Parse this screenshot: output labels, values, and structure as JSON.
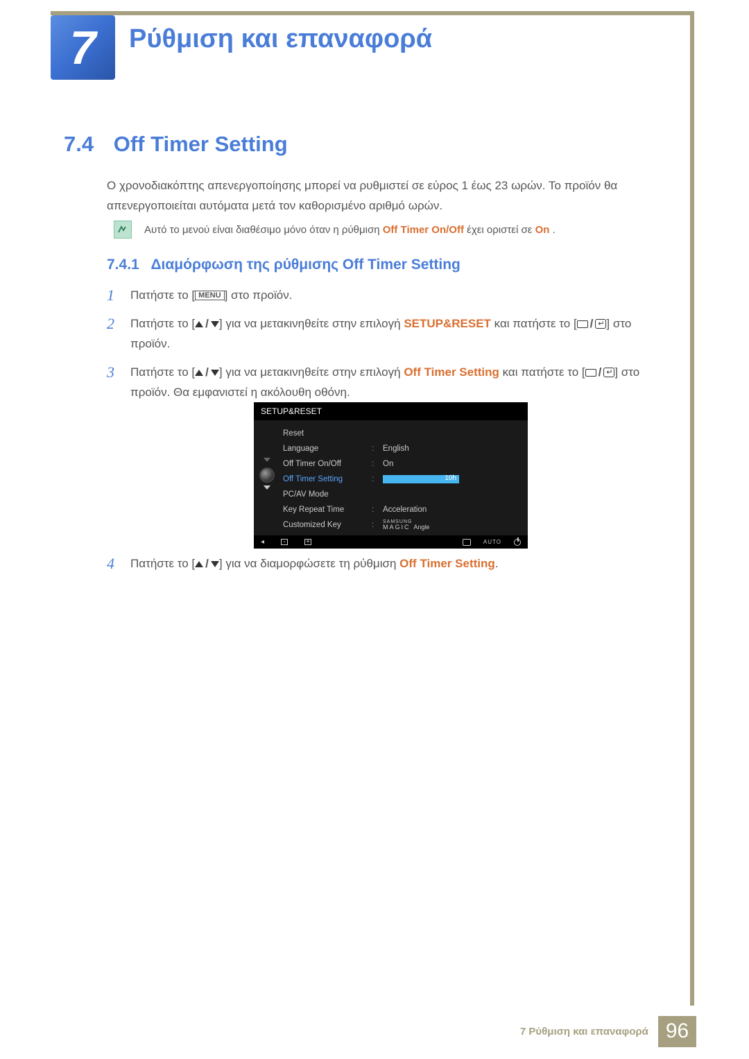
{
  "chapter": {
    "number": "7",
    "title": "Ρύθμιση και επαναφορά"
  },
  "section": {
    "number": "7.4",
    "title": "Off Timer Setting"
  },
  "intro": "Ο χρονοδιακόπτης απενεργοποίησης μπορεί να ρυθμιστεί σε εύρος 1 έως 23 ωρών. Το προϊόν θα απενεργοποιείται αυτόματα μετά τον καθορισμένο αριθμό ωρών.",
  "note": {
    "prefix": "Αυτό το μενού είναι διαθέσιμο μόνο όταν η ρύθμιση ",
    "term1": "Off Timer On/Off",
    "middle": " έχει οριστεί σε ",
    "term2": "On",
    "suffix": "."
  },
  "subsection": {
    "number": "7.4.1",
    "title": "Διαμόρφωση της ρύθμισης Off Timer Setting"
  },
  "steps": {
    "s1": {
      "a": "Πατήστε το [",
      "menu": "MENU",
      "b": "] στο προϊόν."
    },
    "s2": {
      "a": "Πατήστε το [",
      "b": "] για να μετακινηθείτε στην επιλογή ",
      "term": "SETUP&RESET",
      "c": " και πατήστε το [",
      "d": "] στο προϊόν."
    },
    "s3": {
      "a": "Πατήστε το [",
      "b": "] για να μετακινηθείτε στην επιλογή ",
      "term": "Off Timer Setting",
      "c": " και πατήστε το [",
      "d": "] στο προϊόν. Θα εμφανιστεί η ακόλουθη οθόνη."
    },
    "s4": {
      "a": "Πατήστε το [",
      "b": "] για να διαμορφώσετε τη ρύθμιση ",
      "term": "Off Timer Setting",
      "c": "."
    }
  },
  "osd": {
    "title": "SETUP&RESET",
    "rows": {
      "reset": "Reset",
      "language": "Language",
      "language_val": "English",
      "offtimer_onoff": "Off Timer On/Off",
      "offtimer_onoff_val": "On",
      "offtimer_setting": "Off Timer Setting",
      "offtimer_setting_val": "10h",
      "pcav": "PC/AV Mode",
      "keyrepeat": "Key Repeat Time",
      "keyrepeat_val": "Acceleration",
      "customkey": "Customized Key",
      "customkey_val_sup": "SAMSUNG",
      "customkey_val_main": "MAGIC",
      "customkey_val_suffix": " Angle"
    },
    "footer": {
      "auto": "AUTO"
    }
  },
  "footer": {
    "chapter": "7 Ρύθμιση και επαναφορά",
    "page": "96"
  }
}
